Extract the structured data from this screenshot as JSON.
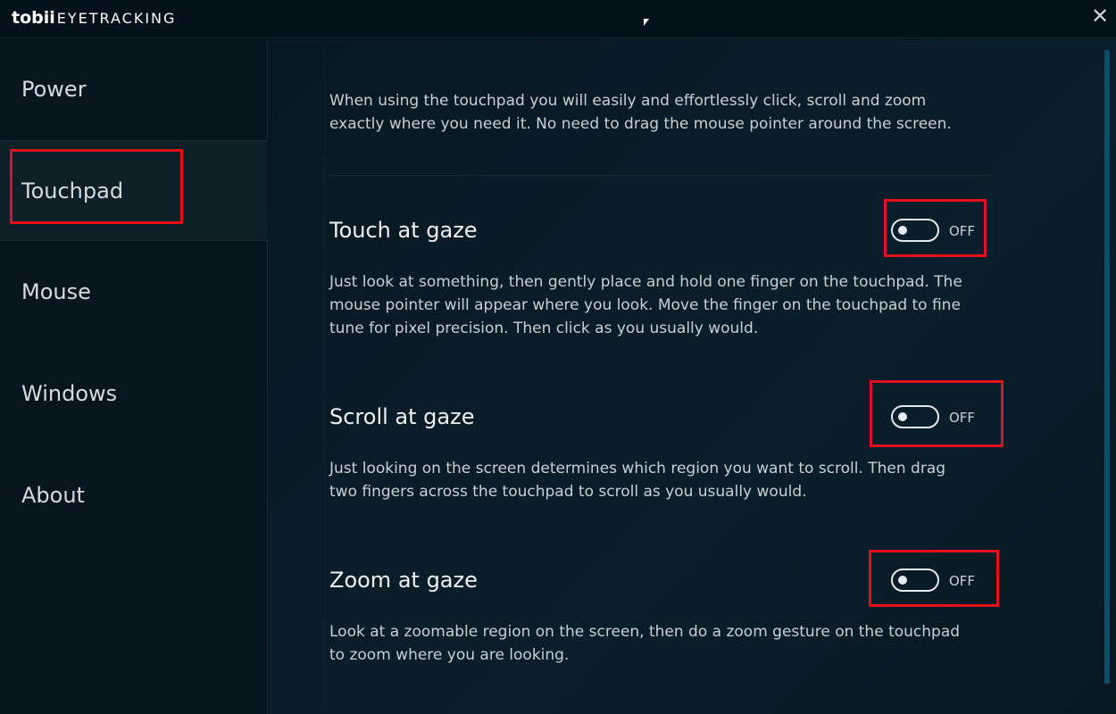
{
  "app": {
    "logo": "tobii",
    "logo_suffix": "EYETRACKING",
    "close_icon": "close-icon"
  },
  "sidebar": {
    "items": [
      {
        "label": "Power"
      },
      {
        "label": "Touchpad",
        "selected": true
      },
      {
        "label": "Mouse"
      },
      {
        "label": "Windows"
      },
      {
        "label": "About"
      }
    ]
  },
  "main": {
    "intro": "When using the touchpad you will easily and effortlessly click, scroll and zoom exactly where you need it. No need to drag the mouse pointer around the screen.",
    "settings": [
      {
        "title": "Touch at gaze",
        "state": "OFF",
        "on": false,
        "description": "Just look at something, then gently place and hold one finger on the touchpad. The mouse pointer will appear where you look. Move the finger on the touchpad to fine tune for pixel precision. Then click as you usually would."
      },
      {
        "title": "Scroll at gaze",
        "state": "OFF",
        "on": false,
        "description": "Just looking on the screen determines which region you want to scroll. Then drag two fingers across the touchpad to scroll as you usually would."
      },
      {
        "title": "Zoom at gaze",
        "state": "OFF",
        "on": false,
        "description": "Look at a zoomable region on the screen, then do a zoom gesture on the touchpad to zoom where you are looking."
      }
    ]
  },
  "colors": {
    "highlight": "#e4101c",
    "background": "#06141d",
    "scrollbar": "#0e4d68"
  }
}
